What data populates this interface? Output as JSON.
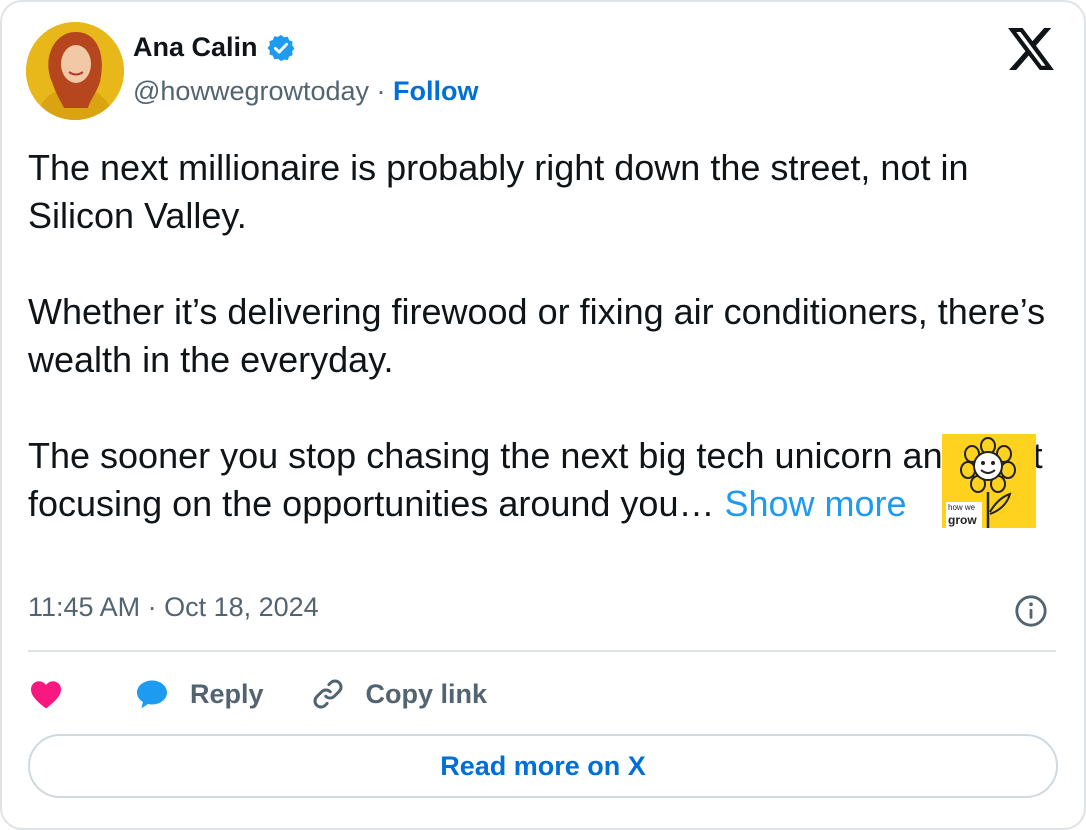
{
  "author": {
    "name": "Ana Calin",
    "handle": "@howwegrowtoday",
    "separator": " · ",
    "follow_label": "Follow",
    "verified": true,
    "verified_color": "#1d9bf0"
  },
  "tweet": {
    "paragraphs": [
      "The next millionaire is probably right down the street, not in Silicon Valley.",
      "Whether it’s delivering firewood or fixing air conditioners, there’s wealth in the everyday."
    ],
    "last_paragraph": "The sooner you stop chasing the next big tech unicorn and start focusing on the opportunities around you… ",
    "show_more_label": "Show more",
    "timestamp": "11:45 AM · Oct 18, 2024"
  },
  "actions": {
    "reply_label": "Reply",
    "copy_link_label": "Copy link",
    "read_more_label": "Read more on X"
  },
  "sticker": {
    "line1": "how we",
    "line2": "grow"
  },
  "icons": {
    "logo": "x-logo-icon",
    "verified": "verified-badge-icon",
    "info": "info-icon",
    "like": "heart-icon",
    "reply": "speech-bubble-icon",
    "copy": "link-icon",
    "sticker": "flower-icon"
  },
  "colors": {
    "link_blue": "#006fd6",
    "show_more_blue": "#1d9bf0",
    "like_pink": "#f91880",
    "muted_text": "#536471",
    "sticker_yellow": "#ffd21f"
  }
}
